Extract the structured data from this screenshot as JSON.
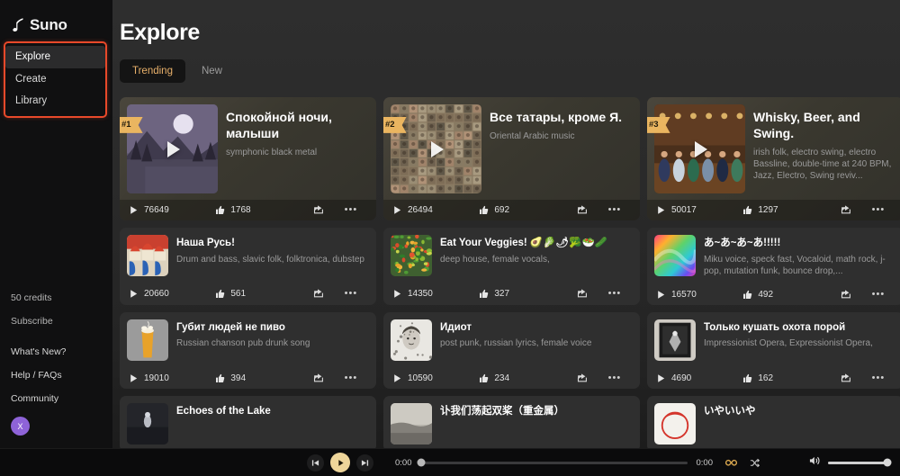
{
  "brand": {
    "name": "Suno",
    "logo_icon": "suno-note-icon"
  },
  "sidebar": {
    "nav": [
      {
        "label": "Explore",
        "name": "explore",
        "active": true
      },
      {
        "label": "Create",
        "name": "create",
        "active": false
      },
      {
        "label": "Library",
        "name": "library",
        "active": false
      }
    ],
    "credits": "50 credits",
    "subscribe": "Subscribe",
    "links": [
      {
        "label": "What's New?",
        "name": "whats-new"
      },
      {
        "label": "Help / FAQs",
        "name": "help-faqs"
      },
      {
        "label": "Community",
        "name": "community"
      }
    ],
    "avatar_initial": "X",
    "avatar_color": "#8e63d8"
  },
  "header": {
    "title": "Explore",
    "tabs": [
      {
        "label": "Trending",
        "name": "trending",
        "active": true
      },
      {
        "label": "New",
        "name": "new",
        "active": false
      }
    ],
    "active_tab_color": "#e8b06a"
  },
  "cards": [
    {
      "rank": "#1",
      "title": "Спокойной ночи, малыши",
      "tags": "symphonic black metal",
      "plays": "76649",
      "likes": "1768",
      "art": "moonlit-mountain-lake"
    },
    {
      "rank": "#2",
      "title": "Все татары, кроме Я.",
      "tags": "Oriental Arabic music",
      "plays": "26494",
      "likes": "692",
      "art": "tiled-mosaic-portraits"
    },
    {
      "rank": "#3",
      "title": "Whisky, Beer, and Swing.",
      "tags": "irish folk, electro swing, electro Bassline, double-time at 240 BPM, Jazz, Electro, Swing reviv...",
      "plays": "50017",
      "likes": "1297",
      "art": "pub-dancers-warm"
    },
    {
      "title": "Наша Русь!",
      "tags": "Drum and bass, slavic folk, folktronica, dubstep",
      "plays": "20660",
      "likes": "561",
      "art": "russian-folk-domes"
    },
    {
      "title": "Eat Your Veggies! 🥑🥬🌶🥦🥗🥒",
      "tags": "deep house, female vocals,",
      "plays": "14350",
      "likes": "327",
      "art": "vegetable-collage"
    },
    {
      "title": "あ~あ~あ~あ!!!!!",
      "tags": "Miku voice, speck fast, Vocaloid, math rock, j-pop, mutation funk, bounce drop,...",
      "plays": "16570",
      "likes": "492",
      "art": "rainbow-swirl"
    },
    {
      "title": "Губит людей не пиво",
      "tags": "Russian chanson pub drunk song",
      "plays": "19010",
      "likes": "394",
      "art": "beer-glass"
    },
    {
      "title": "Идиот",
      "tags": "post punk, russian lyrics, female voice",
      "plays": "10590",
      "likes": "234",
      "art": "sketch-portrait"
    },
    {
      "title": "Только кушать охота порой",
      "tags": "Impressionist Opera, Expressionist Opera,",
      "plays": "4690",
      "likes": "162",
      "art": "bw-framed-figure"
    },
    {
      "title": "Echoes of the Lake",
      "tags": "",
      "plays": "",
      "likes": "",
      "art": "dark-lake-figure"
    },
    {
      "title": "讣我们荡起双桨（重金属）",
      "tags": "",
      "plays": "",
      "likes": "",
      "art": "misty-shore"
    },
    {
      "title": "いやいいや",
      "tags": "",
      "plays": "",
      "likes": "",
      "art": "red-circle-sketch"
    }
  ],
  "player": {
    "prev_icon": "skip-previous-icon",
    "play_icon": "play-icon",
    "next_icon": "skip-next-icon",
    "current_time": "0:00",
    "total_time": "0:00",
    "progress_percent": 0,
    "loop_icon": "infinity-icon",
    "shuffle_icon": "shuffle-icon",
    "volume_icon": "volume-high-icon",
    "volume_percent": 100
  }
}
